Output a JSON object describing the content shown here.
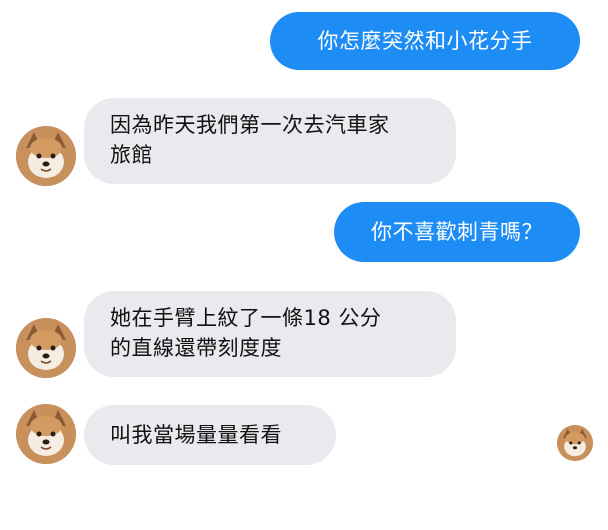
{
  "messages": [
    {
      "direction": "outgoing",
      "text": "你怎麼突然和小花分手"
    },
    {
      "direction": "incoming",
      "lines": [
        "因為昨天我們第一次去汽車家",
        "旅館"
      ]
    },
    {
      "direction": "outgoing",
      "text": "你不喜歡刺青嗎？"
    },
    {
      "direction": "incoming",
      "lines": [
        "她在手臂上紋了一條18 公分",
        "的直線還帶刻度度"
      ]
    },
    {
      "direction": "incoming",
      "lines": [
        "叫我當場量量看看"
      ]
    }
  ],
  "avatar_icon": "shiba-dog-avatar",
  "colors": {
    "outgoing_bubble": "#1e8cf5",
    "incoming_bubble": "#e9eaee"
  }
}
